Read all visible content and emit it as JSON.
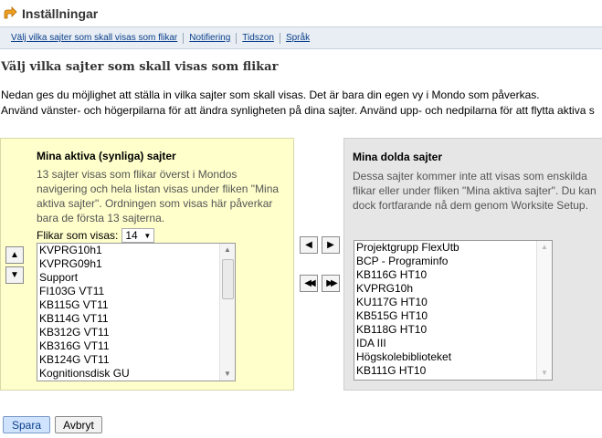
{
  "header": {
    "title": "Inställningar"
  },
  "nav": {
    "links": [
      "Välj vilka sajter som skall visas som flikar",
      "Notifiering",
      "Tidszon",
      "Språk"
    ]
  },
  "page": {
    "heading": "Välj vilka sajter som skall visas som flikar",
    "intro_line1": "Nedan ges du möjlighet att ställa in vilka sajter som skall visas. Det är bara din egen vy i Mondo som påverkas.",
    "intro_line2": "Använd vänster- och högerpilarna för att ändra synligheten på dina sajter. Använd upp- och nedpilarna för att flytta aktiva s"
  },
  "active": {
    "title": "Mina aktiva (synliga) sajter",
    "desc_lines": [
      "13 sajter visas som flikar överst i Mondos",
      "navigering och hela listan visas under fliken \"Mina",
      "aktiva sajter\". Ordningen som visas här påverkar",
      "bara de första 13 sajterna."
    ],
    "flikar_label": "Flikar som visas:",
    "flikar_value": "14",
    "items": [
      "KVPRG10h1",
      "KVPRG09h1",
      "Support",
      "FI103G VT11",
      "KB115G VT11",
      "KB114G VT11",
      "KB312G VT11",
      "KB316G VT11",
      "KB124G VT11",
      "Kognitionsdisk GU"
    ]
  },
  "hidden": {
    "title": "Mina dolda sajter",
    "desc_lines": [
      "Dessa sajter kommer inte att visas som enskilda",
      "flikar eller under fliken \"Mina aktiva sajter\". Du kan",
      "dock fortfarande nå dem genom Worksite Setup."
    ],
    "items": [
      "Projektgrupp FlexUtb",
      "BCP - Programinfo",
      "KB116G HT10",
      "KVPRG10h",
      "KU117G HT10",
      "KB515G HT10",
      "KB118G HT10",
      "IDA III",
      "Högskolebiblioteket",
      "KB111G HT10"
    ]
  },
  "actions": {
    "save": "Spara",
    "cancel": "Avbryt"
  },
  "colors": {
    "active_panel": "#ffffcc",
    "hidden_panel": "#e6e6e6",
    "link": "#0a3e8a"
  }
}
